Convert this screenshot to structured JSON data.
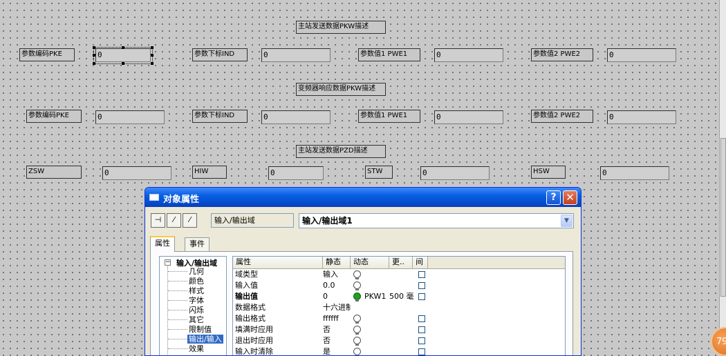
{
  "canvas": {
    "section1_title": "主站发送数据PKW描述",
    "section2_title": "变频器响应数据PKW描述",
    "section3_title": "主站发送数据PZD描述",
    "row1": {
      "label1": "参数编码PKE",
      "value1": "0",
      "label2": "参数下标IND",
      "value2": "0",
      "label3": "参数值1 PWE1",
      "value3": "0",
      "label4": "参数值2 PWE2",
      "value4": "0"
    },
    "row2": {
      "label1": "参数编码PKE",
      "value1": "0",
      "label2": "参数下标IND",
      "value2": "0",
      "label3": "参数值1 PWE1",
      "value3": "0",
      "label4": "参数值2 PWE2",
      "value4": "0"
    },
    "row3": {
      "label1": "ZSW",
      "value1": "0",
      "label2": "HIW",
      "value2": "0",
      "label3": "STW",
      "value3": "0",
      "label4": "HSW",
      "value4": "0"
    }
  },
  "dialog": {
    "title": "对象属性",
    "help_label": "?",
    "close_label": "✕",
    "object_type": "输入/输出域",
    "object_name": "输入/输出域1",
    "combo_arrow": "▼",
    "tools": [
      "pin-icon",
      "pipette-icon",
      "pipette-icon"
    ],
    "tool_glyphs": [
      "⊣",
      "⁄",
      "⁄"
    ],
    "tabs": [
      "属性",
      "事件"
    ],
    "tree": {
      "expander": "−",
      "root": "输入/输出域",
      "items": [
        "几何",
        "颜色",
        "样式",
        "字体",
        "闪烁",
        "其它",
        "限制值",
        "输出/输入",
        "效果"
      ],
      "selected_index": 7
    },
    "grid": {
      "headers": [
        "属性",
        "静态",
        "动态",
        "更..",
        "间"
      ],
      "rows": [
        {
          "name": "域类型",
          "static": "输入",
          "bold": false,
          "dynamic_on": false,
          "dynamic": "",
          "update": "",
          "checked": false
        },
        {
          "name": "输入值",
          "static": "0.0",
          "bold": false,
          "dynamic_on": false,
          "dynamic": "",
          "update": "",
          "checked": false
        },
        {
          "name": "输出值",
          "static": "0",
          "bold": true,
          "dynamic_on": true,
          "dynamic": "PKW1",
          "update": "500 毫",
          "checked": false
        },
        {
          "name": "数据格式",
          "static": "十六进制",
          "bold": false,
          "no_bulb": true,
          "dynamic": "",
          "update": "",
          "checked": null
        },
        {
          "name": "输出格式",
          "static": "ffffff",
          "bold": false,
          "dynamic_on": false,
          "dynamic": "",
          "update": "",
          "checked": false
        },
        {
          "name": "填满时应用",
          "static": "否",
          "bold": false,
          "dynamic_on": false,
          "dynamic": "",
          "update": "",
          "checked": false
        },
        {
          "name": "退出时应用",
          "static": "否",
          "bold": false,
          "dynamic_on": false,
          "dynamic": "",
          "update": "",
          "checked": false
        },
        {
          "name": "输入时清除",
          "static": "是",
          "bold": false,
          "dynamic_on": false,
          "dynamic": "",
          "update": "",
          "checked": false
        }
      ]
    }
  },
  "taskbar_badge": "79",
  "colors": {
    "titlebar": "#0a5fe0",
    "dialog_bg": "#ece9d8",
    "canvas_bg": "#c8c8c8",
    "selection": "#316ac5"
  }
}
